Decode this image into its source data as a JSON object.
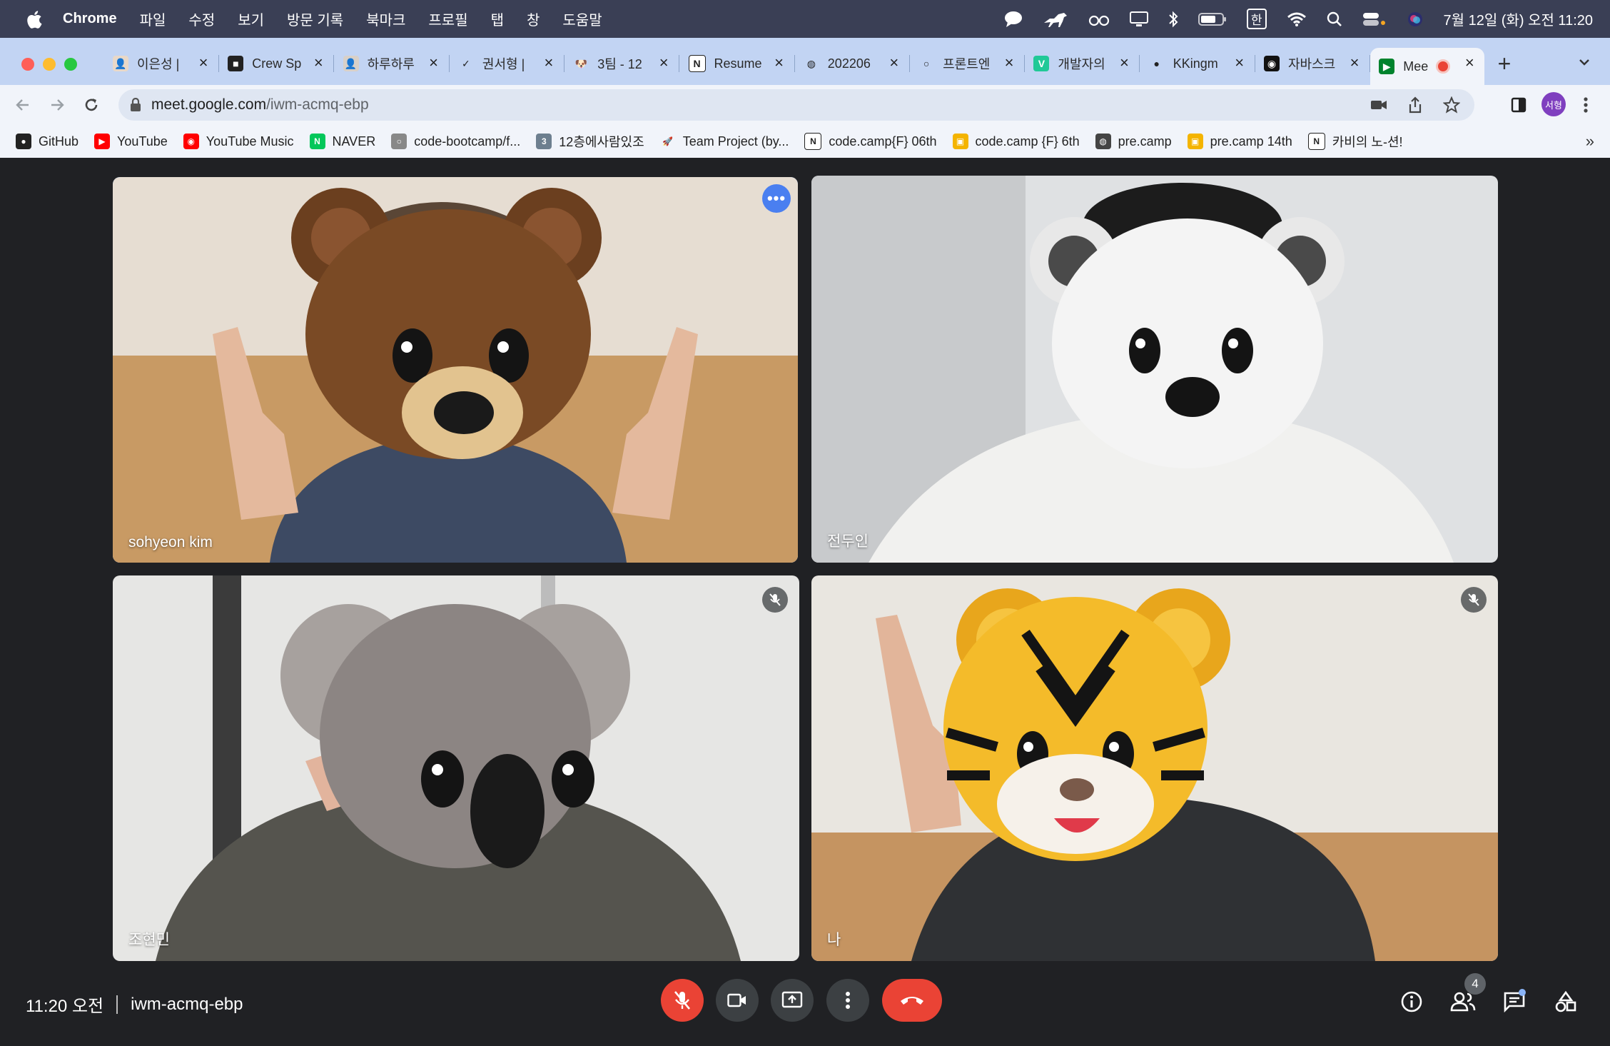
{
  "menubar": {
    "app_name": "Chrome",
    "menus": [
      "파일",
      "수정",
      "보기",
      "방문 기록",
      "북마크",
      "프로필",
      "탭",
      "창",
      "도움말"
    ],
    "ime": "한",
    "clock": "7월 12일 (화) 오전 11:20"
  },
  "tabs": [
    {
      "title": "이은성 |",
      "favicon": "avatar-icon",
      "fav_text": "👤",
      "fav_bg": "#e8d8c8"
    },
    {
      "title": "Crew Sp",
      "favicon": "crew-icon",
      "fav_text": "■",
      "fav_bg": "#222222"
    },
    {
      "title": "하루하루",
      "favicon": "avatar-icon",
      "fav_text": "👤",
      "fav_bg": "#d8d0c8"
    },
    {
      "title": "권서형 |",
      "favicon": "check-icon",
      "fav_text": "✓",
      "fav_bg": "transparent"
    },
    {
      "title": "3팀 - 12",
      "favicon": "dog-icon",
      "fav_text": "🐶",
      "fav_bg": "transparent"
    },
    {
      "title": "Resume",
      "favicon": "notion-icon",
      "fav_text": "N",
      "fav_bg": "#ffffff"
    },
    {
      "title": "202206",
      "favicon": "globe-icon",
      "fav_text": "◍",
      "fav_bg": "transparent"
    },
    {
      "title": "프론트엔",
      "favicon": "circle-icon",
      "fav_text": "○",
      "fav_bg": "transparent"
    },
    {
      "title": "개발자의",
      "favicon": "velog-icon",
      "fav_text": "V",
      "fav_bg": "#20c997"
    },
    {
      "title": "KKingm",
      "favicon": "github-icon",
      "fav_text": "●",
      "fav_bg": "transparent"
    },
    {
      "title": "자바스크",
      "favicon": "video-icon",
      "fav_text": "◉",
      "fav_bg": "#111111"
    },
    {
      "title": "Mee",
      "favicon": "google-meet-icon",
      "fav_text": "▶",
      "fav_bg": "#00832d"
    }
  ],
  "address": {
    "host": "meet.google.com",
    "path": "/iwm-acmq-ebp"
  },
  "profile_initials": "서형",
  "bookmarks": [
    {
      "label": "GitHub",
      "icon": "github-icon",
      "color": "#222222",
      "text": "●"
    },
    {
      "label": "YouTube",
      "icon": "youtube-icon",
      "color": "#ff0000",
      "text": "▶"
    },
    {
      "label": "YouTube Music",
      "icon": "youtube-music-icon",
      "color": "#ff0000",
      "text": "◉"
    },
    {
      "label": "NAVER",
      "icon": "naver-icon",
      "color": "#03c75a",
      "text": "N"
    },
    {
      "label": "code-bootcamp/f...",
      "icon": "github-icon",
      "color": "#888888",
      "text": "○"
    },
    {
      "label": "12층에사람있조",
      "icon": "number-icon",
      "color": "#6d7f8f",
      "text": "3"
    },
    {
      "label": "Team Project (by...",
      "icon": "rocket-icon",
      "color": "transparent",
      "text": "🚀"
    },
    {
      "label": "code.camp{F} 06th",
      "icon": "notion-icon",
      "color": "#ffffff",
      "text": "N"
    },
    {
      "label": "code.camp {F} 6th",
      "icon": "classroom-icon",
      "color": "#f4b400",
      "text": "▣"
    },
    {
      "label": "pre.camp",
      "icon": "globe-icon",
      "color": "#444444",
      "text": "◍"
    },
    {
      "label": "pre.camp 14th",
      "icon": "classroom-icon",
      "color": "#f4b400",
      "text": "▣"
    },
    {
      "label": "카비의 노-션!",
      "icon": "notion-icon",
      "color": "#ffffff",
      "text": "N"
    }
  ],
  "participants": [
    {
      "name": "sohyeon kim",
      "speaking": true,
      "muted": false
    },
    {
      "name": "전두인",
      "speaking": false,
      "muted": false
    },
    {
      "name": "조현민",
      "speaking": false,
      "muted": true
    },
    {
      "name": "나",
      "speaking": false,
      "muted": true
    }
  ],
  "meeting": {
    "time": "11:20 오전",
    "code": "iwm-acmq-ebp",
    "participant_count": "4"
  },
  "colors": {
    "meet_bg": "#202124",
    "control_bg": "#3c4043",
    "danger": "#ea4335",
    "speaking_outline": "#4d8ef7"
  }
}
